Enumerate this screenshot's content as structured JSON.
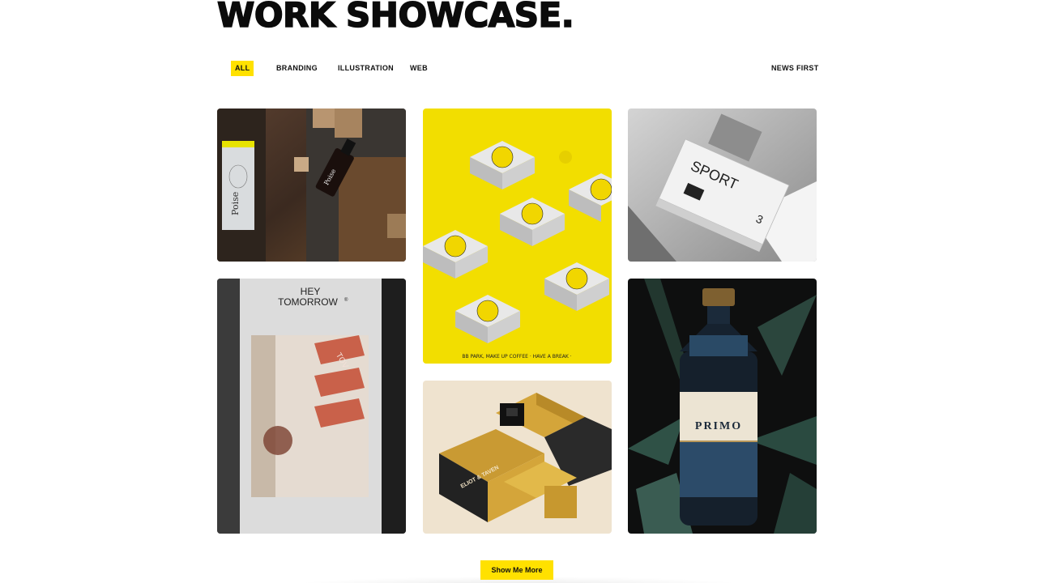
{
  "header": {
    "title": "WORK SHOWCASE."
  },
  "filters": [
    {
      "label": "ALL",
      "active": true
    },
    {
      "label": "BRANDING",
      "active": false
    },
    {
      "label": "ILLUSTRATION",
      "active": false
    },
    {
      "label": "WEB",
      "active": false
    }
  ],
  "sort": {
    "label": "NEWS FIRST"
  },
  "projects": {
    "poise": {
      "brand": "Poise",
      "bottle_label": "Poise"
    },
    "coffee": {
      "ring_text": "BB PARK, MAKE UP COFFEE · HAVE A BREAK ·"
    },
    "sport": {
      "title": "SPORT",
      "number": "3"
    },
    "tomorrow": {
      "line1": "HEY",
      "line2": "TOMORROW",
      "mark": "®",
      "box_text": "TOV"
    },
    "gold": {
      "box_text": "ELIOT & TAVEN"
    },
    "primo": {
      "label": "PRIMO"
    }
  },
  "actions": {
    "show_more": "Show Me More"
  },
  "colors": {
    "accent": "#ffe100",
    "text": "#111111"
  }
}
